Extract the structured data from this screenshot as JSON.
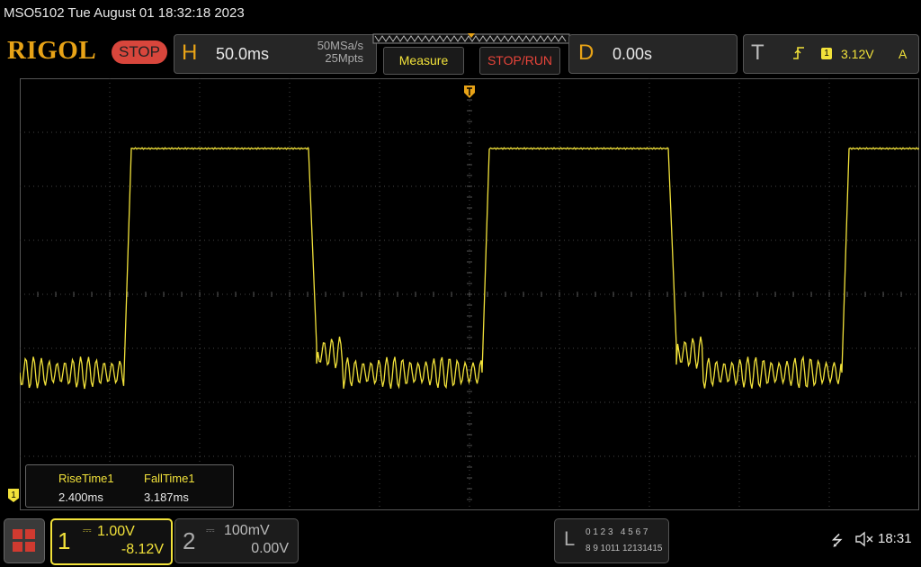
{
  "title_bar": {
    "text": "MSO5102  Tue August 01 18:32:18 2023"
  },
  "toolbar": {
    "logo": "RIGOL",
    "run_state": "STOP",
    "horizontal": {
      "letter": "H",
      "scale": "50.0ms",
      "sample_rate": "50MSa/s",
      "memory_depth": "25Mpts"
    },
    "measure_label": "Measure",
    "stop_run_label": "STOP/RUN",
    "delay": {
      "letter": "D",
      "value": "0.00s"
    },
    "trigger": {
      "letter": "T",
      "slope_icon": "rising-edge-icon",
      "source": "1",
      "level": "3.12V",
      "mode": "A"
    }
  },
  "measurements": [
    {
      "label": "RiseTime1",
      "value": "2.400ms"
    },
    {
      "label": "FallTime1",
      "value": "3.187ms"
    }
  ],
  "channels": {
    "ch1": {
      "number": "1",
      "coupling_icon": "dc-coupling-icon",
      "coupling_glyph": "⎓",
      "scale": "1.00V",
      "offset": "-8.12V",
      "color": "#f2e23a",
      "marker": "1"
    },
    "ch2": {
      "number": "2",
      "coupling_icon": "dc-coupling-icon",
      "coupling_glyph": "⎓",
      "scale": "100mV",
      "offset": "0.00V"
    }
  },
  "logic_analyzer": {
    "letter": "L",
    "row1": "0 1 2 3   4 5 6 7",
    "row2": "8 9 1011 12131415"
  },
  "status": {
    "usb_icon": "usb-icon",
    "usb_glyph": "⭍",
    "sound_icon": "speaker-muted-icon",
    "time": "18:31"
  },
  "colors": {
    "trace": "#f2e23a",
    "accent": "#e8a317",
    "stop": "#d8463c"
  }
}
